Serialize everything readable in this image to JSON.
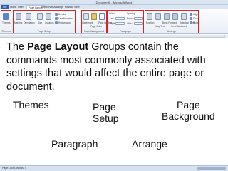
{
  "window": {
    "title": "Document1 - Microsoft Word"
  },
  "tabs": [
    {
      "label": "File"
    },
    {
      "label": "Home"
    },
    {
      "label": "Insert"
    },
    {
      "label": "Page Layout"
    },
    {
      "label": "References"
    },
    {
      "label": "Mailings"
    },
    {
      "label": "Review"
    },
    {
      "label": "View"
    }
  ],
  "ribbon": {
    "groups": [
      {
        "name": "Themes",
        "items": [
          "Themes"
        ]
      },
      {
        "name": "Page Setup",
        "items": [
          "Margins",
          "Orientation",
          "Size",
          "Columns",
          "Breaks",
          "Line Numbers",
          "Hyphenation"
        ]
      },
      {
        "name": "Page Background",
        "items": [
          "Watermark",
          "Page Color",
          "Page Borders"
        ]
      },
      {
        "name": "Paragraph",
        "items": [
          "Indent",
          "Left:",
          "Right:",
          "Spacing",
          "Before:",
          "After:"
        ]
      },
      {
        "name": "Arrange",
        "items": [
          "Position",
          "Wrap Text",
          "Bring Forward",
          "Send Backward",
          "Selection Pane",
          "Align",
          "Group",
          "Rotate"
        ]
      }
    ]
  },
  "slide": {
    "text_part1": "The ",
    "text_bold": "Page Layout",
    "text_part2": " Groups contain the commands most commonly associated with settings that would affect the entire page or document.",
    "captions": {
      "themes": "Themes",
      "page_setup": "Page\nSetup",
      "page_background": "Page\nBackground",
      "paragraph": "Paragraph",
      "arrange": "Arrange"
    }
  },
  "statusbar": {
    "text": "Page: 1 of 1   Words: 0"
  },
  "colors": {
    "highlight": "#e02020",
    "ribbon_bg": "#e8eef7",
    "file_tab": "#2a5aa9"
  }
}
